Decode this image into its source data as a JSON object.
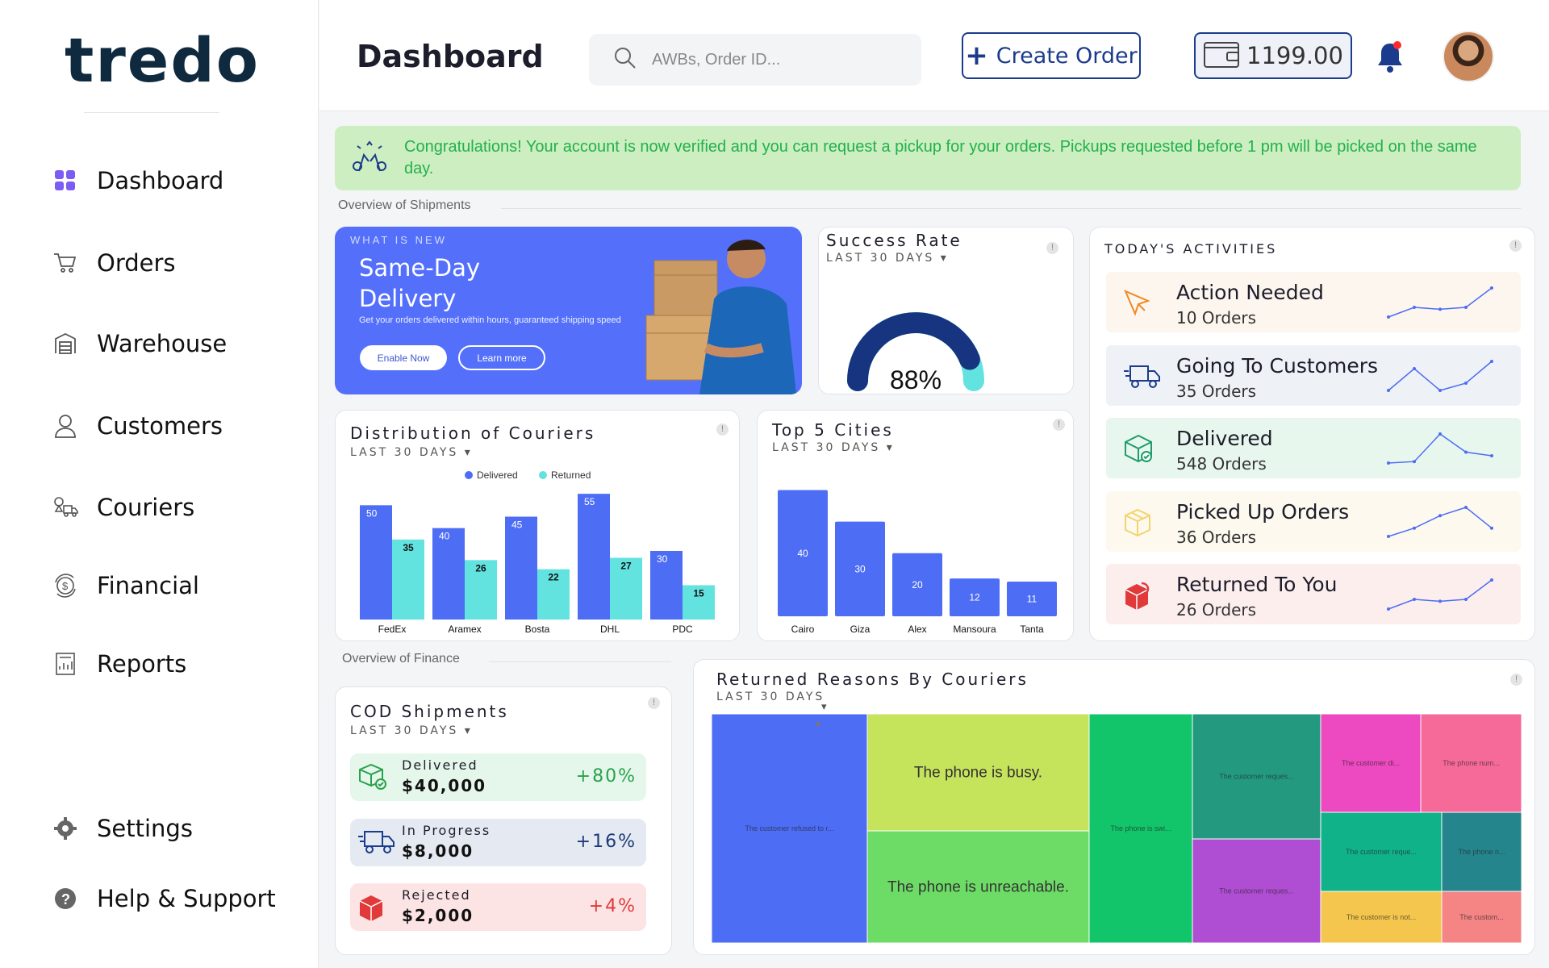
{
  "brand": {
    "logo": "tredo"
  },
  "sidebar": {
    "items": [
      {
        "label": "Dashboard"
      },
      {
        "label": "Orders"
      },
      {
        "label": "Warehouse"
      },
      {
        "label": "Customers"
      },
      {
        "label": "Couriers"
      },
      {
        "label": "Financial"
      },
      {
        "label": "Reports"
      }
    ],
    "bottom": [
      {
        "label": "Settings"
      },
      {
        "label": "Help & Support"
      }
    ]
  },
  "header": {
    "title": "Dashboard",
    "search_placeholder": "AWBs, Order ID...",
    "create_label": "Create Order",
    "wallet_balance": "1199.00"
  },
  "banner": {
    "text": "Congratulations! Your account is now verified and you can request a pickup for your orders. Pickups requested before 1 pm will be picked on the same day."
  },
  "sections": {
    "shipments": "Overview of Shipments",
    "finance": "Overview of Finance"
  },
  "promo": {
    "tag": "WHAT IS NEW",
    "title": "Same-Day Delivery",
    "description": "Get your orders delivered within hours, guaranteed shipping speed",
    "enable_label": "Enable Now",
    "learn_label": "Learn more"
  },
  "success_rate": {
    "title": "Success Rate",
    "period": "LAST 30 DAYS",
    "value": "88%",
    "fraction": 0.88
  },
  "activities": {
    "title": "TODAY'S ACTIVITIES",
    "rows": [
      {
        "title": "Action Needed",
        "count": "10 Orders",
        "bg": "#fdf6ee",
        "line": "#4d6df5",
        "trend": [
          2,
          3,
          2.8,
          3,
          5
        ]
      },
      {
        "title": "Going To Customers",
        "count": "35 Orders",
        "bg": "#eef1f6",
        "line": "#4d6df5",
        "trend": [
          1,
          4,
          1,
          2,
          5
        ]
      },
      {
        "title": "Delivered",
        "count": "548 Orders",
        "bg": "#e8f7ee",
        "line": "#4d6df5",
        "trend": [
          1,
          1.2,
          5,
          2.5,
          2
        ]
      },
      {
        "title": "Picked Up Orders",
        "count": "36 Orders",
        "bg": "#fdf9ee",
        "line": "#4d6df5",
        "trend": [
          1,
          2,
          3.5,
          4.5,
          2
        ]
      },
      {
        "title": "Returned To You",
        "count": "26 Orders",
        "bg": "#fdeeee",
        "line": "#4d6df5",
        "trend": [
          2,
          3,
          2.8,
          3,
          5
        ]
      }
    ]
  },
  "cod": {
    "title": "COD Shipments",
    "period": "LAST 30 DAYS",
    "rows": [
      {
        "label": "Delivered",
        "value": "$40,000",
        "change": "+80%",
        "bg": "#e4f7ea",
        "color": "#2aa14c"
      },
      {
        "label": "In Progress",
        "value": "$8,000",
        "change": "+16%",
        "bg": "#e4e9f2",
        "color": "#1d3a78"
      },
      {
        "label": "Rejected",
        "value": "$2,000",
        "change": "+4%",
        "bg": "#fde4e4",
        "color": "#e03a3a"
      }
    ]
  },
  "chart_data": [
    {
      "type": "bar",
      "title": "Distribution of Couriers",
      "subtitle": "LAST 30 DAYS",
      "categories": [
        "FedEx",
        "Aramex",
        "Bosta",
        "DHL",
        "PDC"
      ],
      "series": [
        {
          "name": "Delivered",
          "color": "#4d6df5",
          "values": [
            50,
            40,
            45,
            55,
            30
          ]
        },
        {
          "name": "Returned",
          "color": "#62e3e0",
          "values": [
            35,
            26,
            22,
            27,
            15
          ]
        }
      ],
      "ylim": [
        0,
        60
      ],
      "legend": "top-center"
    },
    {
      "type": "bar",
      "title": "Top 5 Cities",
      "subtitle": "LAST 30 DAYS",
      "categories": [
        "Cairo",
        "Giza",
        "Alex",
        "Mansoura",
        "Tanta"
      ],
      "values": [
        40,
        30,
        20,
        12,
        11
      ],
      "color": "#4d6df5",
      "ylim": [
        0,
        45
      ]
    },
    {
      "type": "heatmap",
      "title": "Returned Reasons By Couriers",
      "subtitle": "LAST 30 DAYS",
      "tiles": [
        {
          "label": "The customer refused to r...",
          "color": "#4d6df5"
        },
        {
          "label": "The phone is busy.",
          "color": "#c6e35c"
        },
        {
          "label": "The phone is unreachable.",
          "color": "#6ddc66"
        },
        {
          "label": "The phone is swi...",
          "color": "#12c46a"
        },
        {
          "label": "The customer reques...",
          "color": "#239a80"
        },
        {
          "label": "The customer reques...",
          "color": "#b04ed3"
        },
        {
          "label": "The customer di...",
          "color": "#ed49c1"
        },
        {
          "label": "The phone num...",
          "color": "#f56a99"
        },
        {
          "label": "The customer reque...",
          "color": "#10b28a"
        },
        {
          "label": "The phone n...",
          "color": "#25858d"
        },
        {
          "label": "The customer is not...",
          "color": "#f5c64d"
        },
        {
          "label": "The custom...",
          "color": "#f58484"
        }
      ]
    }
  ]
}
